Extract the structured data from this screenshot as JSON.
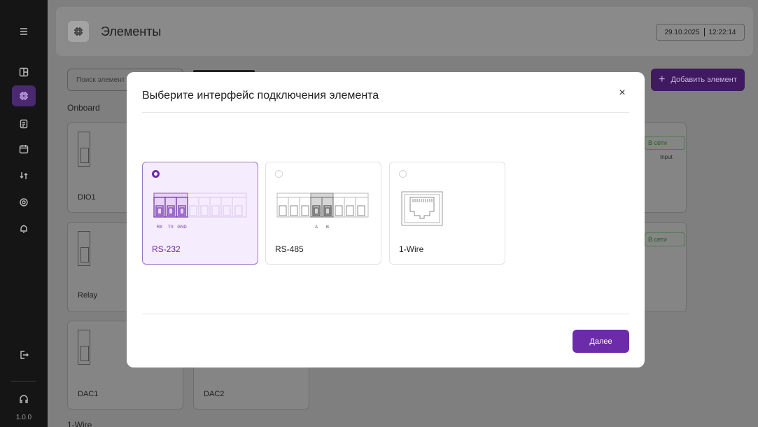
{
  "app": {
    "version": "1.0.0"
  },
  "header": {
    "title": "Элементы",
    "date": "29.10.2025",
    "time": "12:22:14"
  },
  "toolbar": {
    "search_placeholder": "Поиск элемент",
    "add_button": "Добавить элемент"
  },
  "sections": {
    "onboard": "Onboard",
    "one_wire": "1-Wire"
  },
  "background_cards": {
    "dio1": "DIO1",
    "relay": "Relay",
    "dac1": "DAC1",
    "dac2": "DAC2",
    "status_online": "В сети",
    "input_label": "Input"
  },
  "modal": {
    "title": "Выберите интерфейс подключения элемента",
    "close": "×",
    "options": [
      {
        "label": "RS-232",
        "selected": true,
        "pins": [
          "RX",
          "TX",
          "GND"
        ]
      },
      {
        "label": "RS-485",
        "selected": false,
        "pins": [
          "A",
          "B"
        ]
      },
      {
        "label": "1-Wire",
        "selected": false
      }
    ],
    "next_button": "Далее"
  },
  "colors": {
    "accent": "#6c2ba8",
    "accent_light": "#f5ecfd",
    "sidebar": "#151515"
  },
  "icons": {
    "sidebar": [
      "menu-icon",
      "dashboard-icon",
      "chip-icon",
      "document-icon",
      "calendar-icon",
      "sync-icon",
      "settings-icon",
      "bell-icon",
      "logout-icon",
      "headset-icon"
    ]
  }
}
